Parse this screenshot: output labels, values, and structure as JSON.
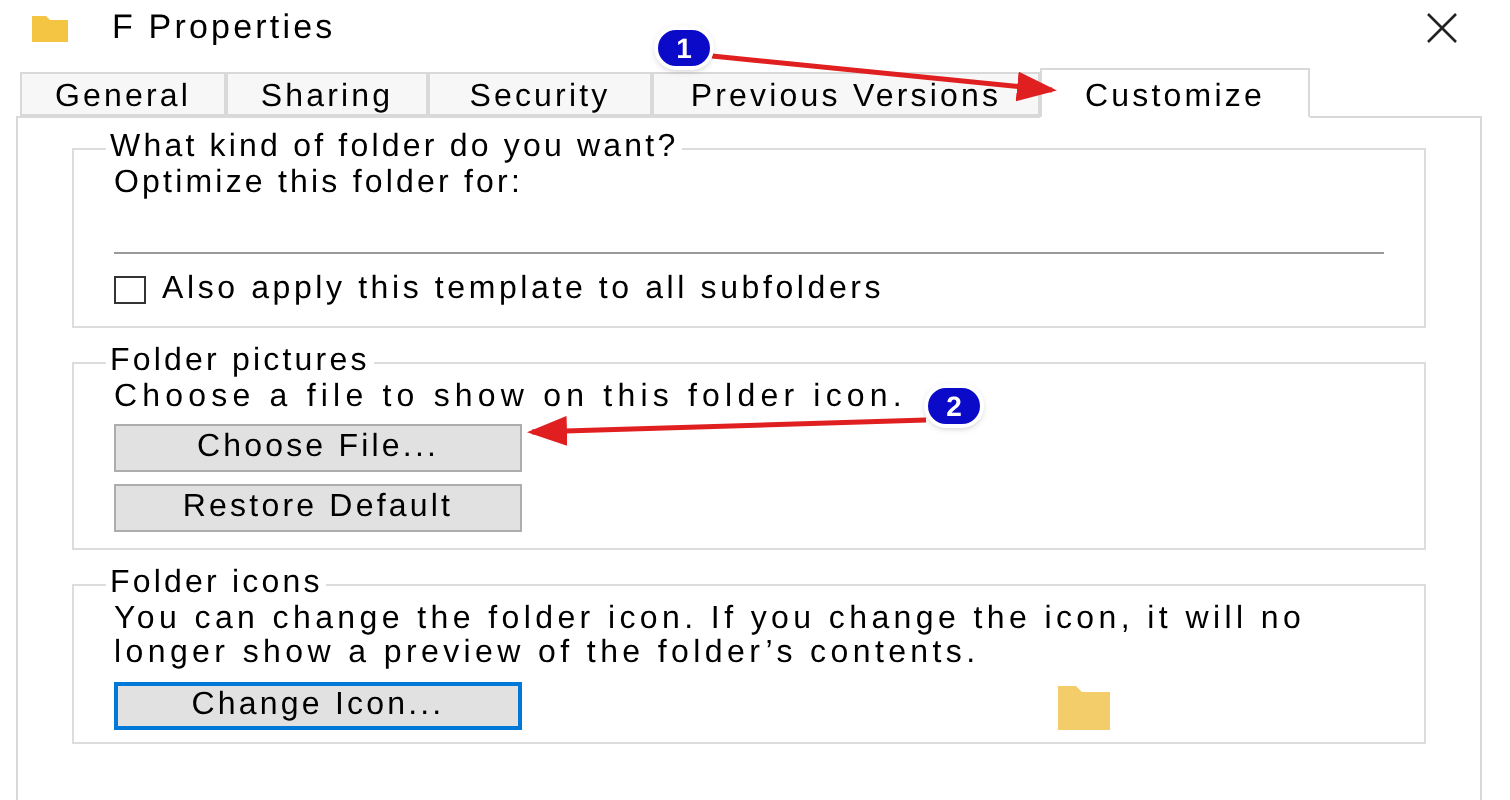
{
  "window": {
    "title": "F Properties"
  },
  "tabs": [
    {
      "label": "General",
      "selected": false
    },
    {
      "label": "Sharing",
      "selected": false
    },
    {
      "label": "Security",
      "selected": false
    },
    {
      "label": "Previous Versions",
      "selected": false
    },
    {
      "label": "Customize",
      "selected": true
    }
  ],
  "template": {
    "legend": "What kind of folder do you want?",
    "optimize_label": "Optimize this folder for:",
    "apply_all": {
      "label": "Also apply this template to all subfolders",
      "checked": false
    }
  },
  "pictures": {
    "legend": "Folder pictures",
    "hint": "Choose a file to show on this folder icon.",
    "buttons": [
      {
        "label": "Choose File...",
        "focused": false
      },
      {
        "label": "Restore Default",
        "focused": false
      }
    ]
  },
  "icons": {
    "legend": "Folder icons",
    "hint": "You can change the folder icon. If you change the icon, it will no longer show a preview of the folder’s contents.",
    "button": {
      "label": "Change Icon...",
      "focused": true
    }
  },
  "callouts": [
    {
      "number": "1"
    },
    {
      "number": "2"
    }
  ]
}
